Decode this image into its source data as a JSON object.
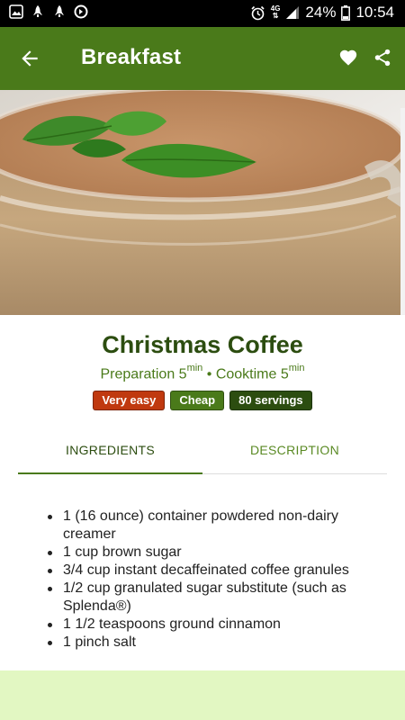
{
  "status_bar": {
    "network": "4G",
    "battery": "24%",
    "time": "10:54"
  },
  "app_bar": {
    "title": "Breakfast"
  },
  "recipe": {
    "title": "Christmas Coffee",
    "preparation_label": "Preparation",
    "preparation_value": "5",
    "cooktime_label": "Cooktime",
    "cooktime_value": "5",
    "unit": "min",
    "separator": "•",
    "badges": [
      {
        "label": "Very easy",
        "color": "#c0390f"
      },
      {
        "label": "Cheap",
        "color": "#4a7a1a"
      },
      {
        "label": "80 servings",
        "color": "#2c4d10"
      }
    ]
  },
  "tabs": [
    {
      "label": "INGREDIENTS",
      "active": true
    },
    {
      "label": "DESCRIPTION",
      "active": false
    }
  ],
  "ingredients": [
    "1 (16 ounce) container powdered non-dairy creamer",
    "1 cup brown sugar",
    "3/4 cup instant decaffeinated coffee granules",
    "1/2 cup granulated sugar substitute (such as Splenda®)",
    "1 1/2 teaspoons ground cinnamon",
    "1 pinch salt"
  ],
  "colors": {
    "primary": "#4a7a1a",
    "primary_dark": "#2c4d10",
    "footer_bg": "#e2f7c2"
  },
  "icons": {
    "back": "arrow-left-icon",
    "favorite": "heart-icon",
    "share": "share-icon"
  }
}
